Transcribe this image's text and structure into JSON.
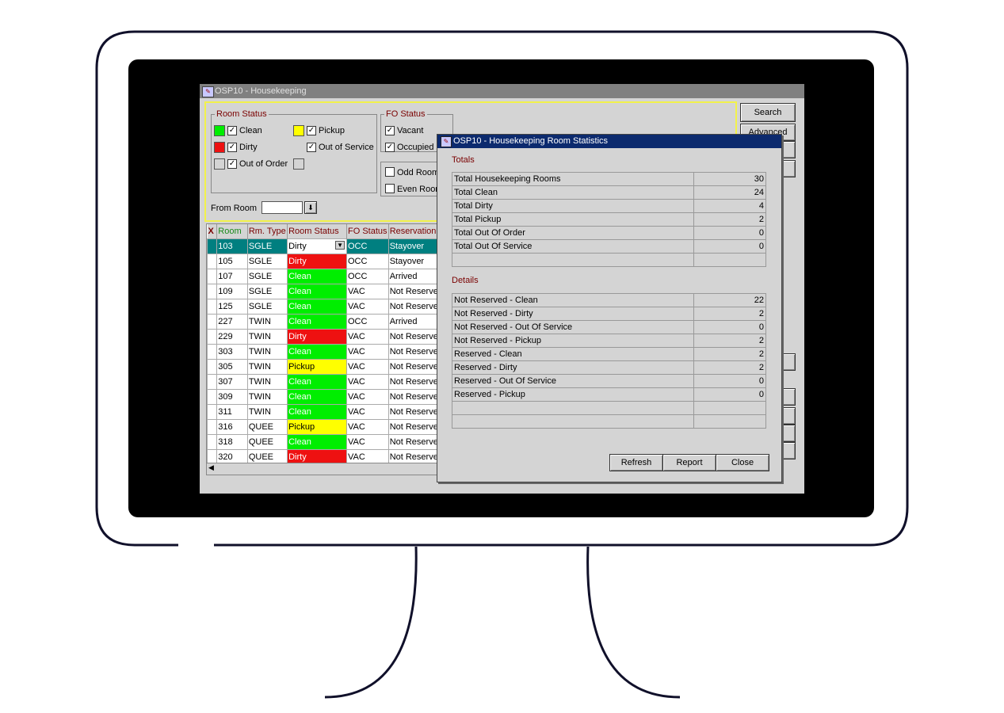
{
  "window": {
    "title": "OSP10 - Housekeeping"
  },
  "filters": {
    "room_status_legend": "Room Status",
    "room_status": [
      {
        "label": "Clean",
        "color": "#00ee00",
        "checked": true
      },
      {
        "label": "Dirty",
        "color": "#ee1111",
        "checked": true
      },
      {
        "label": "Out of Order",
        "color": "#d4d4d4",
        "checked": true
      },
      {
        "label": "Pickup",
        "color": "#ffff00",
        "checked": true
      },
      {
        "label": "Out of Service",
        "checked": true
      }
    ],
    "fo_status_legend": "FO Status",
    "fo_status": [
      {
        "label": "Vacant",
        "checked": true
      },
      {
        "label": "Occupied",
        "checked": true
      }
    ],
    "odd_label": "Odd Room",
    "even_label": "Even Room",
    "from_room_label": "From Room"
  },
  "side_buttons": {
    "search": "Search",
    "advanced": "Advanced"
  },
  "grid": {
    "headers": [
      "X",
      "Room",
      "Rm. Type",
      "Room Status",
      "FO Status",
      "Reservation"
    ],
    "rows": [
      {
        "room": "103",
        "type": "SGLE",
        "status": "Dirty",
        "fo": "OCC",
        "res": "Stayover",
        "selected": true
      },
      {
        "room": "105",
        "type": "SGLE",
        "status": "Dirty",
        "fo": "OCC",
        "res": "Stayover"
      },
      {
        "room": "107",
        "type": "SGLE",
        "status": "Clean",
        "fo": "OCC",
        "res": "Arrived"
      },
      {
        "room": "109",
        "type": "SGLE",
        "status": "Clean",
        "fo": "VAC",
        "res": "Not Reserved"
      },
      {
        "room": "125",
        "type": "SGLE",
        "status": "Clean",
        "fo": "VAC",
        "res": "Not Reserved"
      },
      {
        "room": "227",
        "type": "TWIN",
        "status": "Clean",
        "fo": "OCC",
        "res": "Arrived"
      },
      {
        "room": "229",
        "type": "TWIN",
        "status": "Dirty",
        "fo": "VAC",
        "res": "Not Reserved"
      },
      {
        "room": "303",
        "type": "TWIN",
        "status": "Clean",
        "fo": "VAC",
        "res": "Not Reserved"
      },
      {
        "room": "305",
        "type": "TWIN",
        "status": "Pickup",
        "fo": "VAC",
        "res": "Not Reserved"
      },
      {
        "room": "307",
        "type": "TWIN",
        "status": "Clean",
        "fo": "VAC",
        "res": "Not Reserved"
      },
      {
        "room": "309",
        "type": "TWIN",
        "status": "Clean",
        "fo": "VAC",
        "res": "Not Reserved"
      },
      {
        "room": "311",
        "type": "TWIN",
        "status": "Clean",
        "fo": "VAC",
        "res": "Not Reserved"
      },
      {
        "room": "316",
        "type": "QUEE",
        "status": "Pickup",
        "fo": "VAC",
        "res": "Not Reserved"
      },
      {
        "room": "318",
        "type": "QUEE",
        "status": "Clean",
        "fo": "VAC",
        "res": "Not Reserved"
      },
      {
        "room": "320",
        "type": "QUEE",
        "status": "Dirty",
        "fo": "VAC",
        "res": "Not Reserved"
      }
    ]
  },
  "dialog": {
    "title": "OSP10 - Housekeeping Room Statistics",
    "totals_label": "Totals",
    "totals": [
      {
        "label": "Total Housekeeping Rooms",
        "value": "30"
      },
      {
        "label": "Total Clean",
        "value": "24"
      },
      {
        "label": "Total Dirty",
        "value": "4"
      },
      {
        "label": "Total Pickup",
        "value": "2"
      },
      {
        "label": "Total Out Of Order",
        "value": "0"
      },
      {
        "label": "Total Out Of Service",
        "value": "0"
      }
    ],
    "details_label": "Details",
    "details": [
      {
        "label": "Not Reserved - Clean",
        "value": "22"
      },
      {
        "label": "Not Reserved - Dirty",
        "value": "2"
      },
      {
        "label": "Not Reserved - Out Of Service",
        "value": "0"
      },
      {
        "label": "Not Reserved - Pickup",
        "value": "2"
      },
      {
        "label": "Reserved - Clean",
        "value": "2"
      },
      {
        "label": "Reserved - Dirty",
        "value": "2"
      },
      {
        "label": "Reserved - Out Of Service",
        "value": "0"
      },
      {
        "label": "Reserved - Pickup",
        "value": "0"
      }
    ],
    "buttons": {
      "refresh": "Refresh",
      "report": "Report",
      "close": "Close"
    }
  }
}
